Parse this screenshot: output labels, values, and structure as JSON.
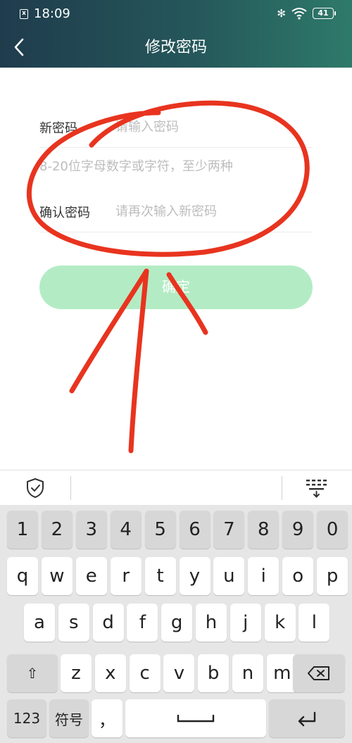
{
  "status_bar": {
    "sim_glyph": "x",
    "time": "18:09",
    "bluetooth_glyph": "✻",
    "battery_level": "41"
  },
  "nav": {
    "title": "修改密码",
    "back_icon": "chevron-left-icon"
  },
  "form": {
    "new_password_label": "新密码",
    "new_password_placeholder": "请输入密码",
    "hint": "8-20位字母数字或字符，至少两种",
    "confirm_label": "确认密码",
    "confirm_placeholder": "请再次输入新密码",
    "submit_label": "确定"
  },
  "keyboard": {
    "row_numbers": [
      "1",
      "2",
      "3",
      "4",
      "5",
      "6",
      "7",
      "8",
      "9",
      "0"
    ],
    "row_top": [
      "q",
      "w",
      "e",
      "r",
      "t",
      "y",
      "u",
      "i",
      "o",
      "p"
    ],
    "row_middle": [
      "a",
      "s",
      "d",
      "f",
      "g",
      "h",
      "j",
      "k",
      "l"
    ],
    "row_bottom": [
      "z",
      "x",
      "c",
      "v",
      "b",
      "n",
      "m"
    ],
    "shift_glyph": "⇧",
    "numbers_label": "123",
    "symbols_label": "符号",
    "comma": "，"
  },
  "colors": {
    "header_start": "#1f3c4d",
    "header_end": "#2e7a6a",
    "button_fill": "#b3ecc4",
    "annotation_red": "#e8341f"
  }
}
